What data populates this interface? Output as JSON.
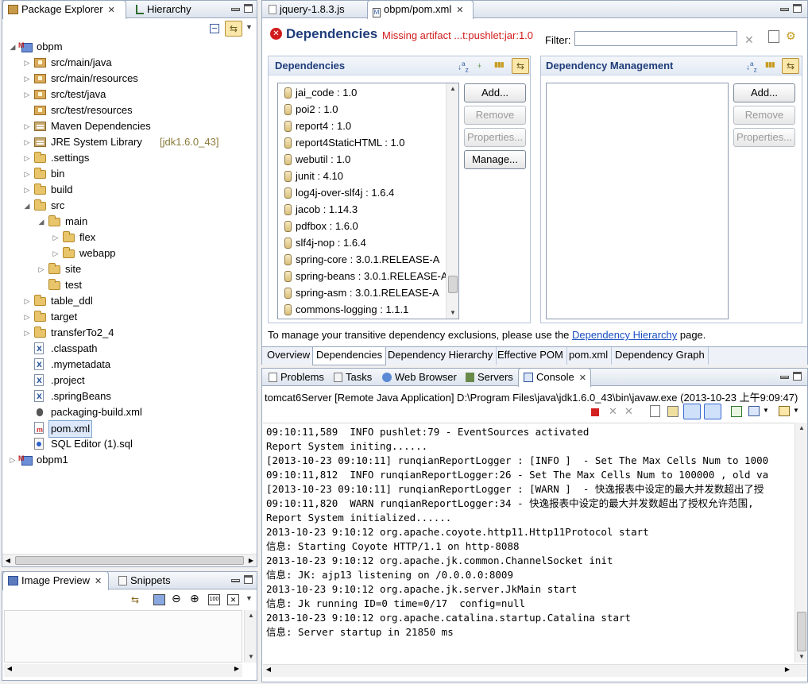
{
  "package_explorer": {
    "tabs": [
      {
        "label": "Package Explorer",
        "close": "✕"
      },
      {
        "label": "Hierarchy"
      }
    ],
    "tree": [
      {
        "label": "obpm",
        "icon": "maven-project-icon",
        "depth": 0,
        "twist": "open"
      },
      {
        "label": "src/main/java",
        "icon": "package-folder-icon",
        "depth": 1,
        "twist": "closed"
      },
      {
        "label": "src/main/resources",
        "icon": "package-folder-icon",
        "depth": 1,
        "twist": "closed"
      },
      {
        "label": "src/test/java",
        "icon": "package-folder-icon",
        "depth": 1,
        "twist": "closed"
      },
      {
        "label": "src/test/resources",
        "icon": "package-folder-icon",
        "depth": 1,
        "twist": "none"
      },
      {
        "label": "Maven Dependencies",
        "icon": "library-icon",
        "depth": 1,
        "twist": "closed"
      },
      {
        "label": "JRE System Library",
        "suffix": "[jdk1.6.0_43]",
        "icon": "library-icon",
        "depth": 1,
        "twist": "closed"
      },
      {
        "label": ".settings",
        "icon": "folder-icon",
        "depth": 1,
        "twist": "closed"
      },
      {
        "label": "bin",
        "icon": "folder-icon",
        "depth": 1,
        "twist": "closed"
      },
      {
        "label": "build",
        "icon": "folder-icon",
        "depth": 1,
        "twist": "closed"
      },
      {
        "label": "src",
        "icon": "folder-icon",
        "depth": 1,
        "twist": "open"
      },
      {
        "label": "main",
        "icon": "folder-icon",
        "depth": 2,
        "twist": "open"
      },
      {
        "label": "flex",
        "icon": "folder-icon",
        "depth": 3,
        "twist": "closed"
      },
      {
        "label": "webapp",
        "icon": "folder-icon",
        "depth": 3,
        "twist": "closed"
      },
      {
        "label": "site",
        "icon": "folder-icon",
        "depth": 2,
        "twist": "closed"
      },
      {
        "label": "test",
        "icon": "folder-icon",
        "depth": 2,
        "twist": "none"
      },
      {
        "label": "table_ddl",
        "icon": "folder-icon",
        "depth": 1,
        "twist": "closed"
      },
      {
        "label": "target",
        "icon": "folder-icon",
        "depth": 1,
        "twist": "closed"
      },
      {
        "label": "transferTo2_4",
        "icon": "folder-icon",
        "depth": 1,
        "twist": "closed"
      },
      {
        "label": ".classpath",
        "icon": "xml-file-icon",
        "depth": 1,
        "twist": "none"
      },
      {
        "label": ".mymetadata",
        "icon": "xml-file-icon",
        "depth": 1,
        "twist": "none"
      },
      {
        "label": ".project",
        "icon": "xml-file-icon",
        "depth": 1,
        "twist": "none"
      },
      {
        "label": ".springBeans",
        "icon": "xml-file-icon",
        "depth": 1,
        "twist": "none"
      },
      {
        "label": "packaging-build.xml",
        "icon": "ant-file-icon",
        "depth": 1,
        "twist": "none"
      },
      {
        "label": "pom.xml",
        "icon": "pom-file-icon",
        "depth": 1,
        "twist": "none",
        "selected": true
      },
      {
        "label": "SQL Editor (1).sql",
        "icon": "sql-file-icon",
        "depth": 1,
        "twist": "none"
      },
      {
        "label": "obpm1",
        "icon": "maven-project-icon",
        "depth": 0,
        "twist": "closed"
      }
    ]
  },
  "image_preview": {
    "tabs": [
      {
        "label": "Image Preview",
        "close": "✕"
      },
      {
        "label": "Snippets"
      }
    ]
  },
  "editor": {
    "tabs": [
      {
        "label": "jquery-1.8.3.js"
      },
      {
        "label": "obpm/pom.xml",
        "close": "✕"
      }
    ],
    "title": "Dependencies",
    "error": "Missing artifact ...t:pushlet:jar:1.0",
    "filter_label": "Filter:",
    "filter_value": "",
    "dependencies": {
      "title": "Dependencies",
      "items": [
        "jai_code : 1.0",
        "poi2 : 1.0",
        "report4 : 1.0",
        "report4StaticHTML : 1.0",
        "webutil : 1.0",
        "junit : 4.10",
        "log4j-over-slf4j : 1.6.4",
        "jacob : 1.14.3",
        "pdfbox : 1.6.0",
        "slf4j-nop : 1.6.4",
        "spring-core : 3.0.1.RELEASE-A",
        "spring-beans : 3.0.1.RELEASE-A",
        "spring-asm : 3.0.1.RELEASE-A",
        "commons-logging : 1.1.1"
      ],
      "buttons": {
        "add": "Add...",
        "remove": "Remove",
        "properties": "Properties...",
        "manage": "Manage..."
      }
    },
    "dependency_management": {
      "title": "Dependency Management",
      "buttons": {
        "add": "Add...",
        "remove": "Remove",
        "properties": "Properties..."
      }
    },
    "hint_prefix": "To manage your transitive dependency exclusions, please use the ",
    "hint_link": "Dependency Hierarchy",
    "hint_suffix": " page.",
    "bottom_tabs": [
      "Overview",
      "Dependencies",
      "Dependency Hierarchy",
      "Effective POM",
      "pom.xml",
      "Dependency Graph"
    ]
  },
  "console_view": {
    "tabs": [
      {
        "label": "Problems"
      },
      {
        "label": "Tasks"
      },
      {
        "label": "Web Browser"
      },
      {
        "label": "Servers"
      },
      {
        "label": "Console",
        "close": "✕"
      }
    ],
    "process": "tomcat6Server [Remote Java Application] D:\\Program Files\\java\\jdk1.6.0_43\\bin\\javaw.exe (2013-10-23 上午9:09:47)",
    "lines": [
      "09:10:11,589  INFO pushlet:79 - EventSources activated",
      "Report System initing......",
      "[2013-10-23 09:10:11] runqianReportLogger : [INFO ]  - Set The Max Cells Num to 1000",
      "09:10:11,812  INFO runqianReportLogger:26 - Set The Max Cells Num to 100000 , old va",
      "[2013-10-23 09:10:11] runqianReportLogger : [WARN ]  - 快逸报表中设定的最大并发数超出了授",
      "09:10:11,820  WARN runqianReportLogger:34 - 快逸报表中设定的最大并发数超出了授权允许范围,",
      "Report System initialized......",
      "2013-10-23 9:10:12 org.apache.coyote.http11.Http11Protocol start",
      "信息: Starting Coyote HTTP/1.1 on http-8088",
      "2013-10-23 9:10:12 org.apache.jk.common.ChannelSocket init",
      "信息: JK: ajp13 listening on /0.0.0.0:8009",
      "2013-10-23 9:10:12 org.apache.jk.server.JkMain start",
      "信息: Jk running ID=0 time=0/17  config=null",
      "2013-10-23 9:10:12 org.apache.catalina.startup.Catalina start",
      "信息: Server startup in 21850 ms"
    ]
  },
  "colors": {
    "accent": "#1f3d7a",
    "error": "#d11b1b",
    "link": "#1a4fc1",
    "selection": "#dde9fb"
  }
}
